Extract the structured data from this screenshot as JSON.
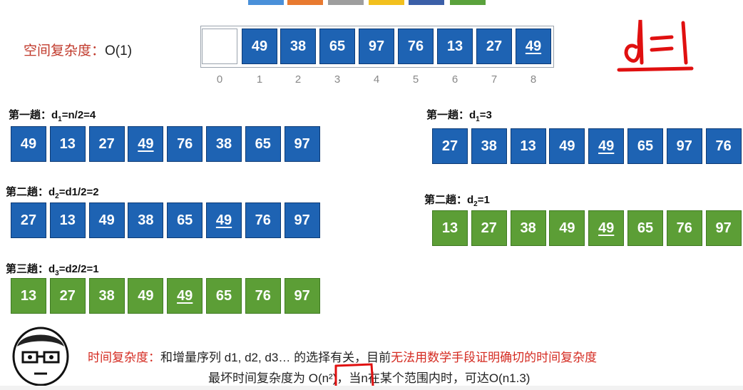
{
  "top_colors": [
    "#4a90d9",
    "#e87a30",
    "#9e9e9e",
    "#f2c01e",
    "#3b5fa8",
    "#5aa23c"
  ],
  "space_complexity": {
    "label": "空间复杂度：",
    "value": "O(1)"
  },
  "array": {
    "indices": [
      "0",
      "1",
      "2",
      "3",
      "4",
      "5",
      "6",
      "7",
      "8"
    ],
    "values": [
      "",
      "49",
      "38",
      "65",
      "97",
      "76",
      "13",
      "27",
      "49"
    ],
    "underlined_index": 8
  },
  "annotation_handwritten": "d=1",
  "left_passes": [
    {
      "label": "第一趟：d",
      "sub": "1",
      "rest": "=n/2=4",
      "values": [
        "49",
        "13",
        "27",
        "49",
        "76",
        "38",
        "65",
        "97"
      ],
      "underline": 3,
      "color": "blue"
    },
    {
      "label": "第二趟：d",
      "sub": "2",
      "rest": "=d1/2=2",
      "values": [
        "27",
        "13",
        "49",
        "38",
        "65",
        "49",
        "76",
        "97"
      ],
      "underline": 5,
      "color": "blue"
    },
    {
      "label": "第三趟：d",
      "sub": "3",
      "rest": "=d2/2=1",
      "values": [
        "13",
        "27",
        "38",
        "49",
        "49",
        "65",
        "76",
        "97"
      ],
      "underline": 4,
      "color": "green"
    }
  ],
  "right_passes": [
    {
      "label": "第一趟：d",
      "sub": "1",
      "rest": "=3",
      "values": [
        "27",
        "38",
        "13",
        "49",
        "49",
        "65",
        "97",
        "76"
      ],
      "underline": 4,
      "color": "blue"
    },
    {
      "label": "第二趟：d",
      "sub": "2",
      "rest": "=1",
      "values": [
        "13",
        "27",
        "38",
        "49",
        "49",
        "65",
        "76",
        "97"
      ],
      "underline": 4,
      "color": "green"
    }
  ],
  "time_note": {
    "line1_red": "时间复杂度：",
    "line1_black": "和增量序列 d1, d2, d3… 的选择有关，目前",
    "line1_red2": "无法用数学手段证明确切的时间复杂度",
    "line2": "最坏时间复杂度为 O(n²)，当n在某个范围内时，可达O(n1.3)"
  }
}
